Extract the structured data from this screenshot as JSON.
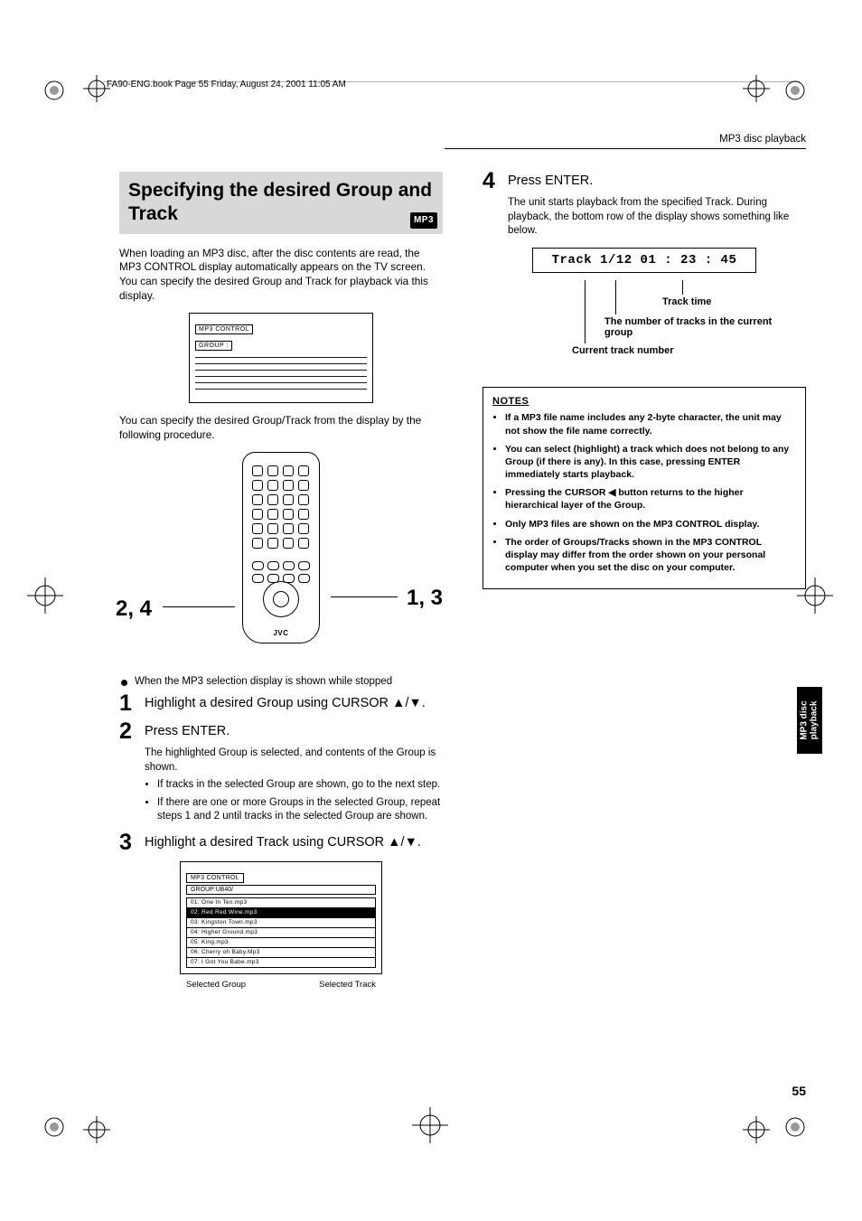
{
  "header": {
    "running": "FA90-ENG.book  Page 55  Friday, August 24, 2001  11:05 AM"
  },
  "section_header": "MP3 disc playback",
  "title": "Specifying the desired Group and Track",
  "badge": "MP3",
  "intro1": "When loading an MP3 disc, after the disc contents are read, the MP3 CONTROL display automatically appears on the TV screen. You can specify the desired Group and Track for playback via this display.",
  "display1": {
    "mp3c": "MP3 CONTROL",
    "group": "GROUP : "
  },
  "intro2": "You can specify the desired Group/Track from the display by the following procedure.",
  "remote": {
    "brand": "JVC",
    "call_left": "2, 4",
    "call_right": "1, 3"
  },
  "lead": "When the MP3 selection display is shown while stopped",
  "steps": {
    "1": {
      "text": "Highlight a desired Group using CURSOR 5/∞."
    },
    "2": {
      "head": "Press ENTER.",
      "body": "The highlighted Group is selected, and contents of the Group is shown.",
      "b1": "If tracks in the selected Group are shown, go to the next step.",
      "b2": "If there are one or more Groups in the selected Group, repeat steps 1 and 2 until tracks in the selected Group are shown."
    },
    "3": {
      "text": "Highlight a desired Track using CURSOR 5/∞."
    },
    "4": {
      "head": "Press ENTER.",
      "body": "The unit starts playback from the specified Track. During playback, the bottom row of the display shows something like below."
    }
  },
  "display2": {
    "hdr": "MP3 CONTROL",
    "grp": "GROUP:UB40/",
    "tracks": [
      "01: One In Ten.mp3",
      "02: Red Red Wine.mp3",
      "03: Kingston Town.mp3",
      "04: Higher Ground.mp3",
      "05: King.mp3",
      "06: Cherry oh Baby.Mp3",
      "07: I Got You Babe.mp3"
    ],
    "sel_idx": 1,
    "cap_left": "Selected Group",
    "cap_right": "Selected Track"
  },
  "track_display": "Track 1/12   01 : 23 : 45",
  "leaders": {
    "l1": "Track time",
    "l2": "The number of tracks in the current group",
    "l3": "Current track number"
  },
  "notes": {
    "hd": "NOTES",
    "items": [
      "If a MP3 file name includes any 2-byte character, the unit may not show the file name correctly.",
      "You can select (highlight) a track which does not belong to any Group (if there is any). In this case, pressing ENTER immediately starts playback.",
      "Pressing the CURSOR 2 button returns to the higher hierarchical layer of the Group.",
      "Only MP3 files are shown on the MP3 CONTROL display.",
      "The order of Groups/Tracks shown in the MP3 CONTROL display may differ from the order shown on your personal computer when you set the disc on your computer."
    ]
  },
  "side_tab": "MP3 disc\nplayback",
  "page_number": "55"
}
